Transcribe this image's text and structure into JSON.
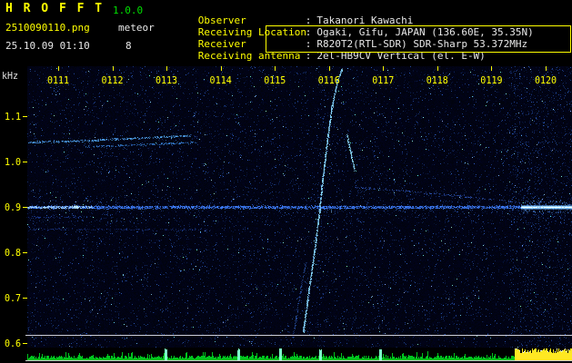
{
  "header": {
    "app_title": "H R O F F T",
    "version": "1.0.0",
    "filename": "2510090110.png",
    "mode_label": "meteor",
    "timestamp": "25.10.09 01:10",
    "echo_count": "8",
    "info_rows": [
      {
        "label": "Observer",
        "sep": ":",
        "value": "Takanori Kawachi"
      },
      {
        "label": "Receiving Location",
        "sep": ":",
        "value": "Ogaki, Gifu, JAPAN (136.60E, 35.35N)"
      },
      {
        "label": "Receiver",
        "sep": ":",
        "value": "R820T2(RTL-SDR) SDR-Sharp 53.372MHz"
      },
      {
        "label": "Receiving antenna",
        "sep": ":",
        "value": "2el-HB9CV Vertical (el. E-W)"
      }
    ]
  },
  "colors": {
    "label_yellow": "#ffff00",
    "version_green": "#00e000",
    "value_white": "#e8e8e8",
    "spectrogram_bg": "#000418",
    "axis_yellow": "#ffff00",
    "axis_unit_white": "#dcdcdc",
    "reference_line_grey": "#cdcdd7",
    "level_bar_green": "#00c41e",
    "level_bar_spike": "#7dffc8",
    "level_bar_strong": "#ffe822"
  },
  "chart_data": {
    "type": "heatmap",
    "title": "HRO meteor-echo spectrogram, 10-minute window starting 01:10",
    "x_axis": {
      "unit": "HHMM",
      "ticks": [
        "0111",
        "0112",
        "0113",
        "0114",
        "0115",
        "0116",
        "0117",
        "0118",
        "0119",
        "0120"
      ]
    },
    "y_axis": {
      "unit": "kHz",
      "ticks": [
        "1.1",
        "1.0",
        "0.9",
        "0.8",
        "0.7",
        "0.6"
      ],
      "range_khz": [
        0.59,
        1.21
      ]
    },
    "carrier_khz": 0.9,
    "reference_line_khz": 0.618,
    "traces": [
      {
        "name": "direct-carrier",
        "style": "speckle-line",
        "color": "#4080ff",
        "width": 1.6,
        "density": 5,
        "alpha": 0.85,
        "points": [
          [
            0.43,
            0.9
          ],
          [
            10.49,
            0.9
          ]
        ]
      },
      {
        "name": "carrier-bright-left",
        "style": "speckle-line",
        "color": "#a8d8ff",
        "width": 1.1,
        "density": 3,
        "alpha": 0.9,
        "points": [
          [
            0.43,
            0.9
          ],
          [
            1.62,
            0.9
          ]
        ]
      },
      {
        "name": "carrier-blob",
        "style": "blob",
        "color": "#c8ecff",
        "width": 3,
        "points": [
          [
            1.32,
            0.9
          ]
        ]
      },
      {
        "name": "carrier-strong-right",
        "style": "band",
        "color": "#bceeff",
        "core": "#f0ffff",
        "width": 4,
        "points": [
          [
            9.55,
            0.9
          ],
          [
            10.49,
            0.9
          ]
        ]
      },
      {
        "name": "upper-echo-a1",
        "style": "speckle-line",
        "color": "#57b0ff",
        "width": 1,
        "density": 2.2,
        "alpha": 0.8,
        "points": [
          [
            0.43,
            1.043
          ],
          [
            1.75,
            1.047
          ]
        ]
      },
      {
        "name": "upper-echo-a2",
        "style": "speckle-line",
        "color": "#57b0ff",
        "width": 1,
        "density": 2.2,
        "alpha": 0.8,
        "points": [
          [
            1.72,
            1.048
          ],
          [
            3.45,
            1.058
          ]
        ]
      },
      {
        "name": "upper-echo-b",
        "style": "speckle-line",
        "color": "#3d8de8",
        "width": 1,
        "density": 1.8,
        "alpha": 0.7,
        "points": [
          [
            1.5,
            1.033
          ],
          [
            3.55,
            1.043
          ]
        ]
      },
      {
        "name": "sub-carrier-faint",
        "style": "speckle-line",
        "color": "#2a55cc",
        "width": 1,
        "density": 1.2,
        "alpha": 0.55,
        "points": [
          [
            0.43,
            0.878
          ],
          [
            1.45,
            0.878
          ]
        ]
      },
      {
        "name": "low-line-085",
        "style": "speckle-line",
        "color": "#2a50c0",
        "width": 1,
        "density": 0.9,
        "alpha": 0.5,
        "points": [
          [
            0.43,
            0.852
          ],
          [
            3.8,
            0.85
          ]
        ]
      },
      {
        "name": "head-echo-main",
        "style": "speckle-line",
        "color": "#86d6ff",
        "width": 1.5,
        "density": 3.5,
        "alpha": 0.9,
        "points": [
          [
            5.52,
            0.624
          ],
          [
            5.63,
            0.72
          ],
          [
            5.74,
            0.81
          ],
          [
            5.82,
            0.89
          ],
          [
            5.89,
            0.97
          ],
          [
            5.97,
            1.05
          ],
          [
            6.05,
            1.12
          ],
          [
            6.15,
            1.176
          ],
          [
            6.24,
            1.205
          ]
        ]
      },
      {
        "name": "head-echo-branch",
        "style": "speckle-line",
        "color": "#3a6fd8",
        "width": 1,
        "density": 1.5,
        "alpha": 0.55,
        "points": [
          [
            5.33,
            0.612
          ],
          [
            5.45,
            0.7
          ],
          [
            5.57,
            0.78
          ]
        ]
      },
      {
        "name": "echo-dash",
        "style": "speckle-line",
        "color": "#90e2ff",
        "width": 1.5,
        "density": 3,
        "alpha": 0.9,
        "points": [
          [
            6.33,
            1.058
          ],
          [
            6.4,
            1.02
          ],
          [
            6.47,
            0.982
          ]
        ]
      },
      {
        "name": "drift-echo-right",
        "style": "speckle-line",
        "color": "#3a6ae0",
        "width": 1,
        "density": 1.1,
        "alpha": 0.6,
        "points": [
          [
            6.47,
            0.944
          ],
          [
            7.4,
            0.936
          ],
          [
            8.3,
            0.926
          ],
          [
            9.45,
            0.912
          ]
        ]
      }
    ],
    "level_bar": {
      "spike_minutes": [
        2.98,
        4.32,
        5.1,
        5.84,
        6.94
      ],
      "strong_region_minutes": [
        9.43,
        10.5
      ]
    }
  }
}
